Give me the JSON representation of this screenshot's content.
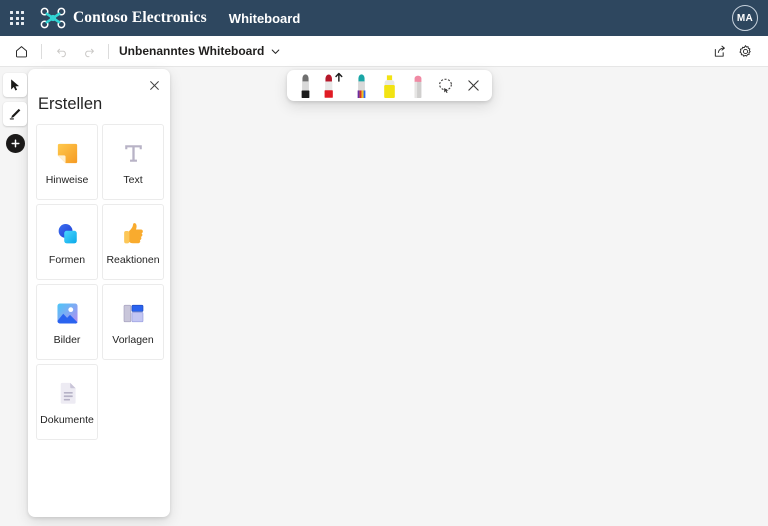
{
  "header": {
    "waffle_label": "app-launcher",
    "brand": "Contoso Electronics",
    "app": "Whiteboard",
    "avatar_initials": "MA",
    "bar_color": "#2e475f"
  },
  "command_bar": {
    "home_label": "Home",
    "undo_label": "Undo",
    "redo_label": "Redo",
    "doc_title": "Unbenanntes Whiteboard",
    "share_label": "Share",
    "settings_label": "Settings"
  },
  "tool_rail": {
    "items": [
      {
        "name": "select-tool",
        "label": "Select"
      },
      {
        "name": "pen-tool",
        "label": "Pen"
      },
      {
        "name": "create-tool",
        "label": "Create"
      }
    ]
  },
  "create_panel": {
    "title": "Erstellen",
    "close_label": "Close",
    "cards": [
      {
        "label": "Hinweise",
        "icon": "sticky-note-icon"
      },
      {
        "label": "Text",
        "icon": "text-icon"
      },
      {
        "label": "Formen",
        "icon": "shapes-icon"
      },
      {
        "label": "Reaktionen",
        "icon": "thumbs-up-icon"
      },
      {
        "label": "Bilder",
        "icon": "image-icon"
      },
      {
        "label": "Vorlagen",
        "icon": "templates-icon"
      },
      {
        "label": "Dokumente",
        "icon": "document-icon"
      }
    ]
  },
  "pen_toolbar": {
    "items": [
      {
        "name": "pen-black",
        "label": "Black pen",
        "color": "#1b1b1b",
        "selected": false
      },
      {
        "name": "pen-red",
        "label": "Red pen",
        "color": "#e01b24",
        "selected": true
      },
      {
        "name": "pen-rainbow",
        "label": "Rainbow pen",
        "color": "#6b3fa0",
        "selected": false
      },
      {
        "name": "highlighter-yellow",
        "label": "Yellow highlighter",
        "color": "#f2e313",
        "selected": false
      },
      {
        "name": "eraser",
        "label": "Eraser",
        "color": "#f5a3b5",
        "selected": false
      },
      {
        "name": "lasso-select",
        "label": "Lasso select",
        "color": "#3b3a39",
        "selected": false
      },
      {
        "name": "close-pen-toolbar",
        "label": "Close",
        "color": "#3b3a39",
        "selected": false
      }
    ]
  },
  "colors": {
    "canvas_bg": "#f5f5f5",
    "panel_bg": "#ffffff",
    "text": "#242424"
  }
}
